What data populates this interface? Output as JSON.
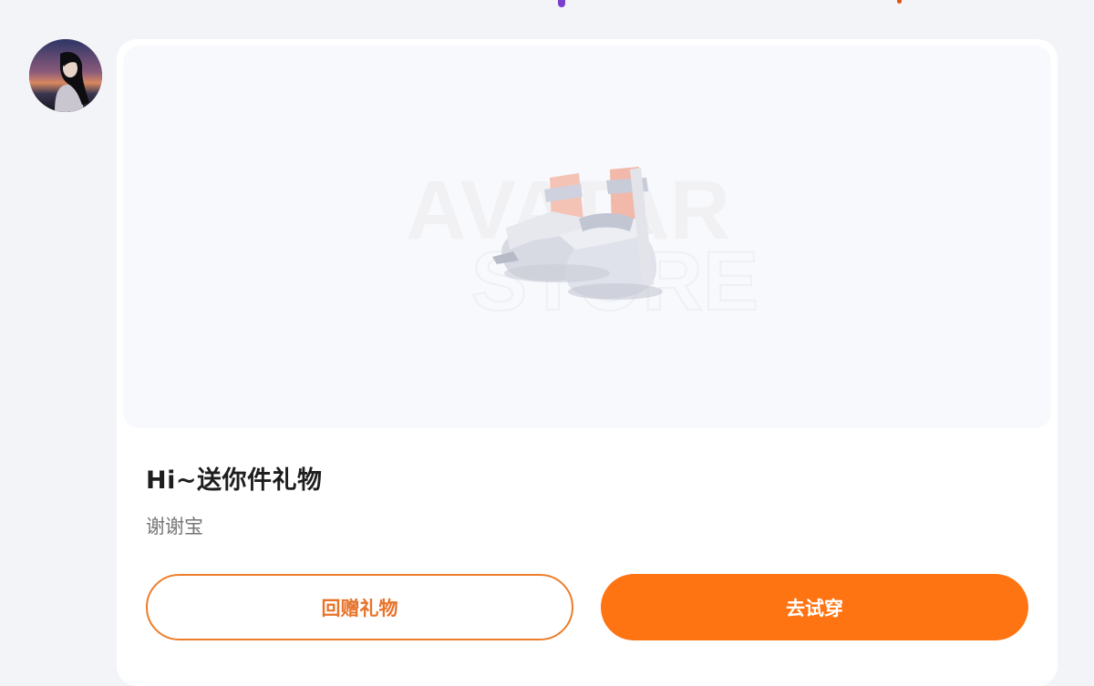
{
  "avatar": {
    "name": "user-avatar"
  },
  "gift_card": {
    "watermark_line1": "AVATAR",
    "watermark_line2": "STORE",
    "item_icon": "platform-shoes-image",
    "title": "Hi~送你件礼物",
    "message": "谢谢宝",
    "buttons": {
      "return_gift_label": "回赠礼物",
      "try_on_label": "去试穿"
    }
  },
  "colors": {
    "page_background": "#f3f4f7",
    "card_background": "#ffffff",
    "preview_background": "#f7f9fc",
    "accent_orange": "#ff7412",
    "outline_orange": "#ec7d2a",
    "title_text": "#1e1e1e",
    "message_text": "#757575"
  }
}
